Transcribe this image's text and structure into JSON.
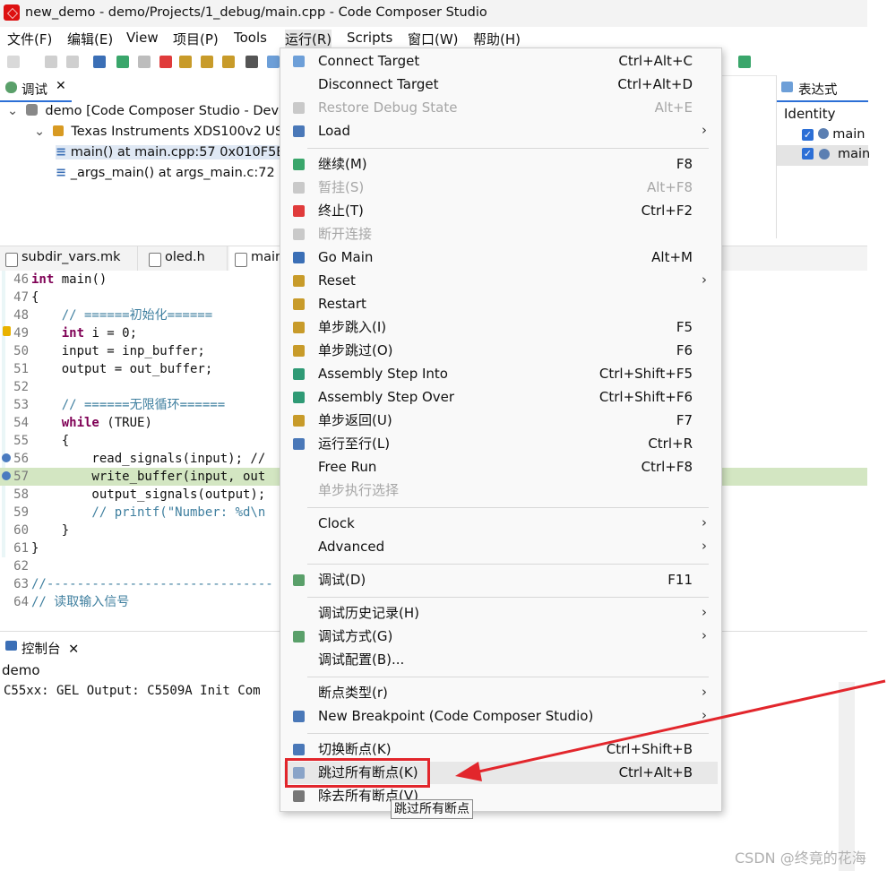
{
  "window": {
    "title": "new_demo - demo/Projects/1_debug/main.cpp - Code Composer Studio"
  },
  "menubar": [
    "文件(F)",
    "编辑(E)",
    "View",
    "项目(P)",
    "Tools",
    "运行(R)",
    "Scripts",
    "窗口(W)",
    "帮助(H)"
  ],
  "debug_view": {
    "tab_label": "调试",
    "tree": [
      "demo [Code Composer Studio - Dev",
      "Texas Instruments XDS100v2 USB",
      "main() at main.cpp:57 0x010F5E",
      "_args_main() at args_main.c:72"
    ]
  },
  "right_panel": {
    "tab_label": "表达式",
    "header": "Identity",
    "rows": [
      "main",
      "main"
    ]
  },
  "editor": {
    "tabs": [
      "subdir_vars.mk",
      "oled.h",
      "main"
    ],
    "lines": [
      {
        "n": "46",
        "code": "int main()"
      },
      {
        "n": "47",
        "code": "{"
      },
      {
        "n": "48",
        "code": "    // ======初始化======"
      },
      {
        "n": "49",
        "code": "    int i = 0;"
      },
      {
        "n": "50",
        "code": "    input = inp_buffer;"
      },
      {
        "n": "51",
        "code": "    output = out_buffer;"
      },
      {
        "n": "52",
        "code": ""
      },
      {
        "n": "53",
        "code": "    // ======无限循环======"
      },
      {
        "n": "54",
        "code": "    while (TRUE)"
      },
      {
        "n": "55",
        "code": "    {"
      },
      {
        "n": "56",
        "code": "        read_signals(input); //"
      },
      {
        "n": "57",
        "code": "        write_buffer(input, out"
      },
      {
        "n": "58",
        "code": "        output_signals(output);"
      },
      {
        "n": "59",
        "code": "        // printf(\"Number: %d\\n"
      },
      {
        "n": "60",
        "code": "    }"
      },
      {
        "n": "61",
        "code": "}"
      },
      {
        "n": "62",
        "code": ""
      },
      {
        "n": "63",
        "code": "//------------------------------"
      },
      {
        "n": "64",
        "code": "// 读取输入信号"
      }
    ]
  },
  "console": {
    "tab_label": "控制台",
    "project": "demo",
    "output": "C55xx: GEL Output: C5509A Init Com"
  },
  "context_menu": {
    "items": [
      {
        "label": "Connect Target",
        "shortcut": "Ctrl+Alt+C",
        "icon": "connect-icon"
      },
      {
        "label": "Disconnect Target",
        "shortcut": "Ctrl+Alt+D"
      },
      {
        "label": "Restore Debug State",
        "shortcut": "Alt+E",
        "disabled": true,
        "icon": "restore-icon"
      },
      {
        "label": "Load",
        "submenu": true,
        "icon": "load-icon"
      },
      {
        "sep": true
      },
      {
        "label": "继续(M)",
        "shortcut": "F8",
        "icon": "resume-icon"
      },
      {
        "label": "暂挂(S)",
        "shortcut": "Alt+F8",
        "disabled": true,
        "icon": "suspend-icon"
      },
      {
        "label": "终止(T)",
        "shortcut": "Ctrl+F2",
        "icon": "terminate-icon"
      },
      {
        "label": "断开连接",
        "disabled": true,
        "icon": "disconnect-icon"
      },
      {
        "label": "Go Main",
        "shortcut": "Alt+M",
        "icon": "go-main-icon"
      },
      {
        "label": "Reset",
        "submenu": true,
        "icon": "reset-icon"
      },
      {
        "label": "Restart",
        "icon": "restart-icon"
      },
      {
        "label": "单步跳入(I)",
        "shortcut": "F5",
        "icon": "step-into-icon"
      },
      {
        "label": "单步跳过(O)",
        "shortcut": "F6",
        "icon": "step-over-icon"
      },
      {
        "label": "Assembly Step Into",
        "shortcut": "Ctrl+Shift+F5",
        "icon": "asm-step-into-icon"
      },
      {
        "label": "Assembly Step Over",
        "shortcut": "Ctrl+Shift+F6",
        "icon": "asm-step-over-icon"
      },
      {
        "label": "单步返回(U)",
        "shortcut": "F7",
        "icon": "step-return-icon"
      },
      {
        "label": "运行至行(L)",
        "shortcut": "Ctrl+R",
        "icon": "run-to-line-icon"
      },
      {
        "label": "Free Run",
        "shortcut": "Ctrl+F8"
      },
      {
        "label": "单步执行选择",
        "disabled": true
      },
      {
        "sep": true
      },
      {
        "label": "Clock",
        "submenu": true
      },
      {
        "label": "Advanced",
        "submenu": true
      },
      {
        "sep": true
      },
      {
        "label": "调试(D)",
        "shortcut": "F11",
        "icon": "debug-icon"
      },
      {
        "sep": true
      },
      {
        "label": "调试历史记录(H)",
        "submenu": true
      },
      {
        "label": "调试方式(G)",
        "submenu": true,
        "icon": "debug-as-icon"
      },
      {
        "label": "调试配置(B)...",
        "icon": ""
      },
      {
        "sep": true
      },
      {
        "label": "断点类型(r)",
        "submenu": true
      },
      {
        "label": "New Breakpoint (Code Composer Studio)",
        "submenu": true,
        "icon": "breakpoint-new-icon"
      },
      {
        "sep": true
      },
      {
        "label": "切换断点(K)",
        "shortcut": "Ctrl+Shift+B",
        "icon": "toggle-breakpoint-icon"
      },
      {
        "label": "跳过所有断点(K)",
        "shortcut": "Ctrl+Alt+B",
        "icon": "skip-breakpoints-icon",
        "hover": true
      },
      {
        "label": "除去所有断点(V)",
        "icon": "remove-breakpoints-icon"
      }
    ]
  },
  "tooltip": "跳过所有断点",
  "watermark": "CSDN @终竟的花海",
  "colors": {
    "highlight": "#e2262c",
    "current_line": "#d3e6c2",
    "keyword": "#7f0055"
  }
}
